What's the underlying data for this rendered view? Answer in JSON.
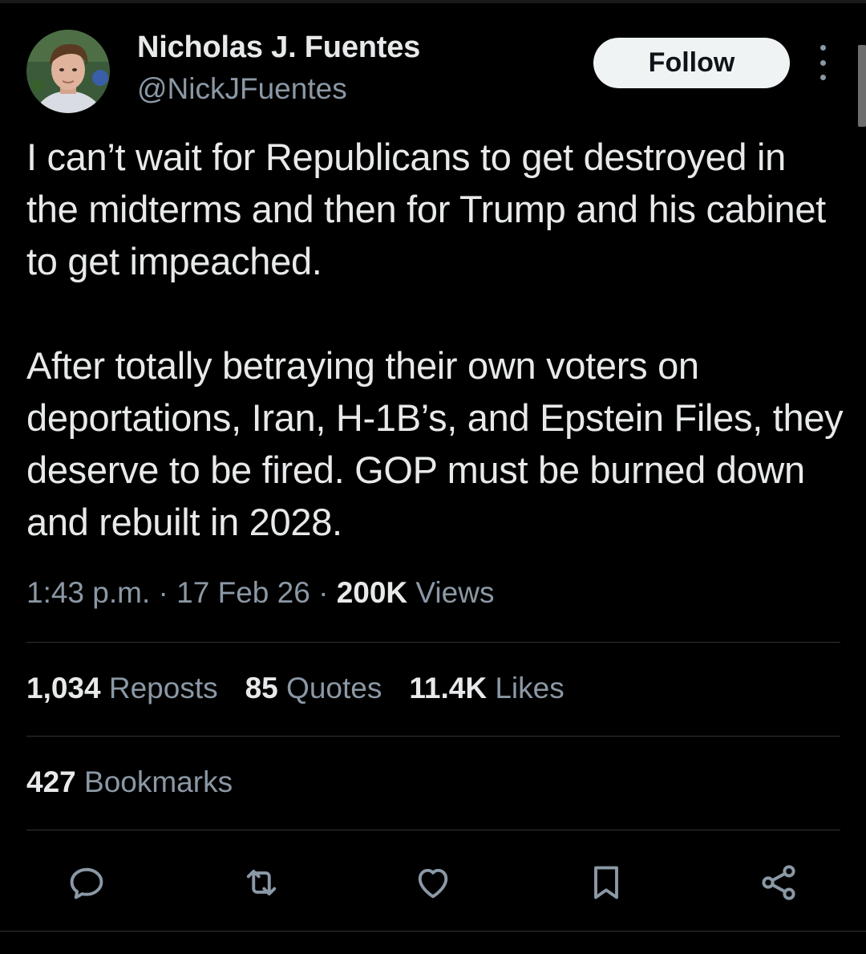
{
  "author": {
    "display_name": "Nicholas J. Fuentes",
    "handle": "@NickJFuentes",
    "avatar_alt": "profile photo"
  },
  "header": {
    "follow_label": "Follow"
  },
  "tweet": {
    "paragraphs": [
      "I can’t wait for Republicans to get destroyed in the midterms and then for Trump and his cabinet to get impeached.",
      "After totally betraying their own voters on deportations, Iran, H-1B’s, and Epstein Files, they deserve to be fired. GOP must be burned down and rebuilt in 2028."
    ]
  },
  "meta": {
    "time": "1:43 p.m.",
    "separator": " · ",
    "date": "17 Feb 26",
    "views_count": "200K",
    "views_label": " Views"
  },
  "stats": {
    "reposts_count": "1,034",
    "reposts_label": " Reposts",
    "quotes_count": "85",
    "quotes_label": " Quotes",
    "likes_count": "11.4K",
    "likes_label": " Likes",
    "bookmarks_count": "427",
    "bookmarks_label": " Bookmarks"
  },
  "actions": {
    "icons": [
      "reply-icon",
      "repost-icon",
      "like-icon",
      "bookmark-icon",
      "share-icon"
    ]
  },
  "colors": {
    "background": "#000000",
    "text_primary": "#e7e9ea",
    "text_secondary": "#8b98a5",
    "divider": "#2f3336",
    "follow_bg": "#eff3f4"
  }
}
